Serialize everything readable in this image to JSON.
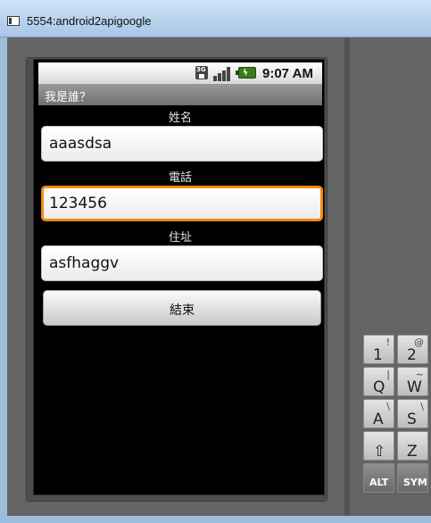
{
  "window": {
    "title": "5554:android2apigoogle"
  },
  "status_bar": {
    "network_label": "3G",
    "time": "9:07 AM"
  },
  "app": {
    "title": "我是誰？",
    "fields": [
      {
        "label": "姓名",
        "value": "aaasdsa"
      },
      {
        "label": "電話",
        "value": "123456"
      },
      {
        "label": "住址",
        "value": "asfhaggv"
      }
    ],
    "button_label": "結束"
  },
  "keyboard": {
    "keys": [
      {
        "main": "1",
        "sub": "!"
      },
      {
        "main": "2",
        "sub": "@"
      },
      {
        "main": "Q",
        "sub": "|"
      },
      {
        "main": "W",
        "sub": "~"
      },
      {
        "main": "A",
        "sub": "\\"
      },
      {
        "main": "S",
        "sub": "\\"
      },
      {
        "main": "⇧",
        "sub": ""
      },
      {
        "main": "Z",
        "sub": ""
      },
      {
        "main": "ALT",
        "sub": ""
      },
      {
        "main": "SYM",
        "sub": ""
      }
    ]
  },
  "colors": {
    "focus_border": "#f08c14",
    "battery": "#3a7a1a"
  }
}
